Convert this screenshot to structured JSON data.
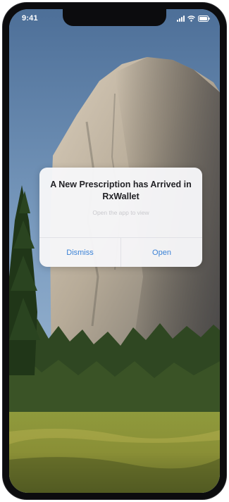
{
  "status_bar": {
    "time": "9:41",
    "icons": [
      "signal-icon",
      "wifi-icon",
      "battery-icon"
    ]
  },
  "wallpaper": {
    "description_icon": "mountain-forest-meadow-wallpaper"
  },
  "alert": {
    "title": "A New Prescription has Arrived in RxWallet",
    "message": "Open the app to view",
    "dismiss_label": "Dismiss",
    "open_label": "Open",
    "button_color": "#3b82d6"
  }
}
